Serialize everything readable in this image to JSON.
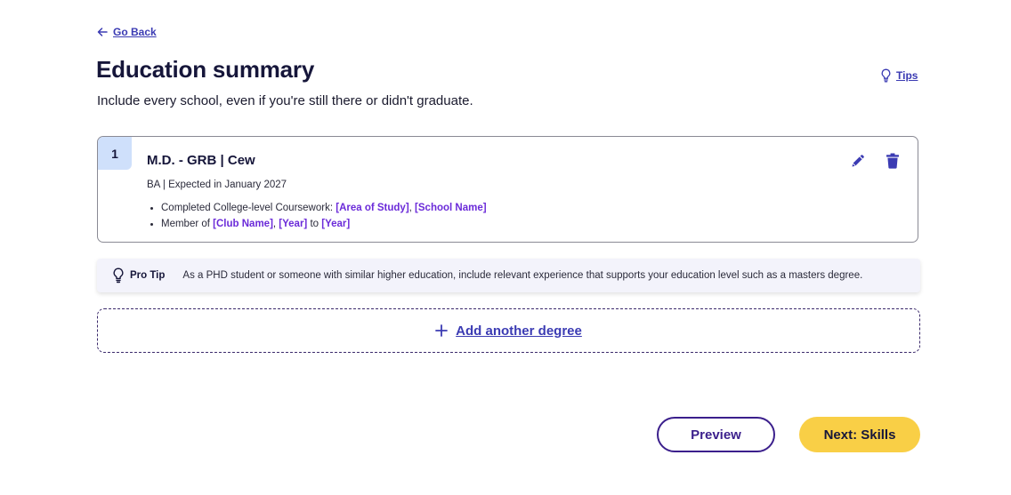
{
  "nav": {
    "back_label": "Go Back",
    "back_icon": "arrow-left-icon"
  },
  "header": {
    "title": "Education summary",
    "subtitle": "Include every school, even if you're still there or didn't graduate.",
    "tips_label": "Tips",
    "tips_icon": "lightbulb-icon"
  },
  "education": {
    "entries": [
      {
        "index": "1",
        "title": "M.D. - GRB | Cew",
        "meta": "BA | Expected in January 2027",
        "bullets": [
          {
            "prefix": "Completed College-level Coursework: ",
            "ph1": "[Area of Study]",
            "sep1": ", ",
            "ph2": "[School Name]"
          },
          {
            "prefix": "Member of ",
            "ph1": "[Club Name]",
            "sep1": ", ",
            "ph2": "[Year]",
            "sep2": " to ",
            "ph3": "[Year]"
          }
        ],
        "edit_icon": "pencil-icon",
        "delete_icon": "trash-icon"
      }
    ]
  },
  "pro_tip": {
    "label": "Pro Tip",
    "text": "As a PHD student or someone with similar higher education, include relevant experience that supports your education level such as a masters degree."
  },
  "add_degree": {
    "label": "Add another degree",
    "icon": "plus-icon"
  },
  "footer": {
    "preview_label": "Preview",
    "next_label": "Next: Skills"
  },
  "colors": {
    "link": "#3b3bb3",
    "placeholder": "#6b2bd9",
    "index_badge": "#cfe0fb",
    "next_button": "#f9cf46",
    "preview_border": "#3b1f8c",
    "pro_tip_bg": "#f3f3fb"
  }
}
